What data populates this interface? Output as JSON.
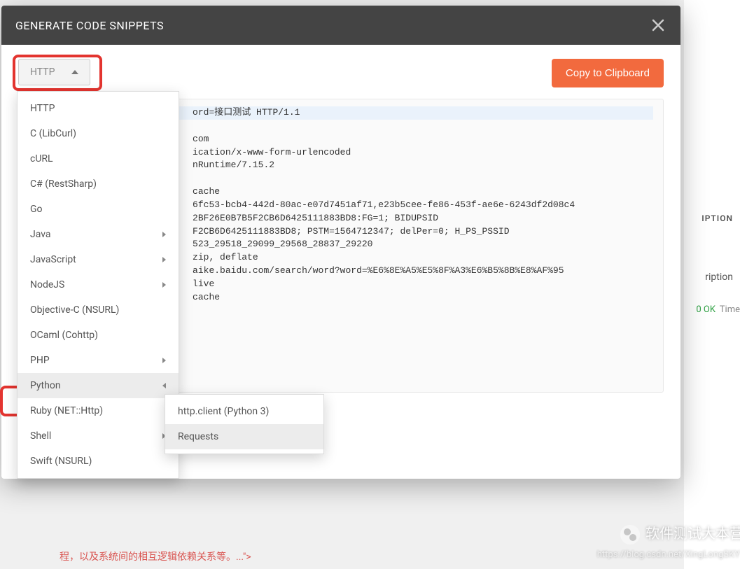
{
  "modal": {
    "title": "GENERATE CODE SNIPPETS",
    "copy_label": "Copy to Clipboard",
    "dropdown_label": "HTTP"
  },
  "menu": {
    "items": [
      {
        "label": "HTTP",
        "has_sub": false
      },
      {
        "label": "C (LibCurl)",
        "has_sub": false
      },
      {
        "label": "cURL",
        "has_sub": false
      },
      {
        "label": "C# (RestSharp)",
        "has_sub": false
      },
      {
        "label": "Go",
        "has_sub": false
      },
      {
        "label": "Java",
        "has_sub": true
      },
      {
        "label": "JavaScript",
        "has_sub": true
      },
      {
        "label": "NodeJS",
        "has_sub": true
      },
      {
        "label": "Objective-C (NSURL)",
        "has_sub": false
      },
      {
        "label": "OCaml (Cohttp)",
        "has_sub": false
      },
      {
        "label": "PHP",
        "has_sub": true
      },
      {
        "label": "Python",
        "has_sub": true,
        "active": true
      },
      {
        "label": "Ruby (NET::Http)",
        "has_sub": false
      },
      {
        "label": "Shell",
        "has_sub": true
      },
      {
        "label": "Swift (NSURL)",
        "has_sub": false
      }
    ]
  },
  "submenu": {
    "items": [
      {
        "label": "http.client (Python 3)"
      },
      {
        "label": "Requests",
        "active": true
      }
    ]
  },
  "code": {
    "line1_suffix": "ord=接口测试 HTTP/1.1",
    "line2": "com",
    "line3": "ication/x-www-form-urlencoded",
    "line4": "nRuntime/7.15.2",
    "line5": "",
    "line6": "cache",
    "line7": "6fc53-bcb4-442d-80ac-e07d7451af71,e23b5cee-fe86-453f-ae6e-6243df2d08c4",
    "line8": "2BF26E0B7B5F2CB6D6425111883BD8:FG=1; BIDUPSID",
    "line9": "F2CB6D6425111883BD8; PSTM=1564712347; delPer=0; H_PS_PSSID",
    "line10": "523_29518_29099_29568_28837_29220",
    "line11": "zip, deflate",
    "line12": "aike.baidu.com/search/word?word=%E6%8E%A5%E5%8F%A3%E6%B5%8B%E8%AF%95",
    "line13": "live",
    "line14": "cache"
  },
  "background": {
    "desc_header": "IPTION",
    "ription": "ription",
    "ok": "0 OK",
    "time": "Time",
    "bottom_text": "程，以及系统间的相互逻辑依赖关系等。...\">"
  },
  "watermark": {
    "main": "软件测试大本营",
    "sub": "https://blog.csdn.net/XingLongSKY"
  }
}
